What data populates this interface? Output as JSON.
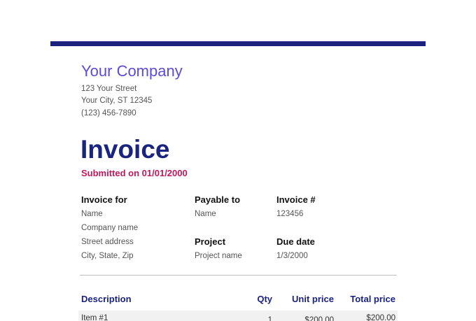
{
  "colors": {
    "accent_bar": "#1a237e",
    "company_name": "#5c4bd6",
    "title": "#1a237e",
    "submitted": "#c2185b"
  },
  "company": {
    "name": "Your Company",
    "street": "123 Your Street",
    "city": "Your City, ST 12345",
    "phone": "(123) 456-7890"
  },
  "invoice": {
    "title": "Invoice",
    "submitted": "Submitted on 01/01/2000"
  },
  "fields": {
    "invoice_for": {
      "label": "Invoice for",
      "name": "Name",
      "company": "Company name",
      "street": "Street address",
      "city": "City, State, Zip"
    },
    "payable_to": {
      "label": "Payable to",
      "name": "Name"
    },
    "invoice_number": {
      "label": "Invoice #",
      "value": "123456"
    },
    "project": {
      "label": "Project",
      "value": "Project name"
    },
    "due_date": {
      "label": "Due date",
      "value": "1/3/2000"
    }
  },
  "table": {
    "headers": {
      "description": "Description",
      "qty": "Qty",
      "unit_price": "Unit price",
      "total_price": "Total price"
    },
    "rows": [
      {
        "description": "Item #1",
        "qty": "1",
        "unit_price": "$200.00",
        "total_price": "$200.00"
      }
    ]
  }
}
